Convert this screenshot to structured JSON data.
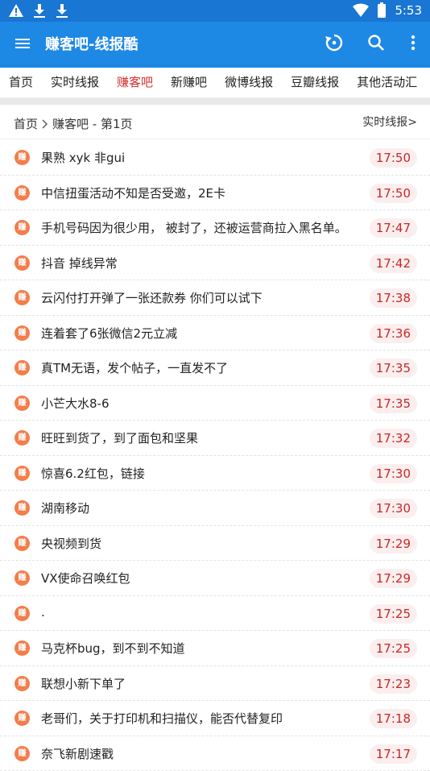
{
  "status": {
    "time": "5:53"
  },
  "appbar": {
    "title": "赚客吧-线报酷"
  },
  "tabs": [
    "首页",
    "实时线报",
    "赚客吧",
    "新赚吧",
    "微博线报",
    "豆瓣线报",
    "其他活动汇"
  ],
  "active_tab": 2,
  "breadcrumb": {
    "home": "首页",
    "section": "赚客吧 - 第1页",
    "right_link": "实时线报>"
  },
  "badge_text": "赚",
  "items": [
    {
      "title": "果熟 xyk 非gui",
      "time": "17:50"
    },
    {
      "title": "中信扭蛋活动不知是否受邀，2E卡",
      "time": "17:50"
    },
    {
      "title": "手机号码因为很少用， 被封了，还被运营商拉入黑名单。",
      "time": "17:47"
    },
    {
      "title": "抖音 掉线异常",
      "time": "17:42"
    },
    {
      "title": "云闪付打开弹了一张还款券 你们可以试下",
      "time": "17:38"
    },
    {
      "title": "连着套了6张微信2元立减",
      "time": "17:36"
    },
    {
      "title": "真TM无语，发个帖子，一直发不了",
      "time": "17:35"
    },
    {
      "title": "小芒大水8-6",
      "time": "17:35"
    },
    {
      "title": "旺旺到货了，到了面包和坚果",
      "time": "17:32"
    },
    {
      "title": "惊喜6.2红包，链接",
      "time": "17:30"
    },
    {
      "title": "湖南移动",
      "time": "17:30"
    },
    {
      "title": "央视频到货",
      "time": "17:29"
    },
    {
      "title": "VX使命召唤红包",
      "time": "17:29"
    },
    {
      "title": ".",
      "time": "17:25"
    },
    {
      "title": "马克杯bug，到不到不知道",
      "time": "17:25"
    },
    {
      "title": "联想小新下单了",
      "time": "17:23"
    },
    {
      "title": "老哥们，关于打印机和扫描仪，能否代替复印",
      "time": "17:18"
    },
    {
      "title": "奈飞新剧速戳",
      "time": "17:17"
    }
  ]
}
